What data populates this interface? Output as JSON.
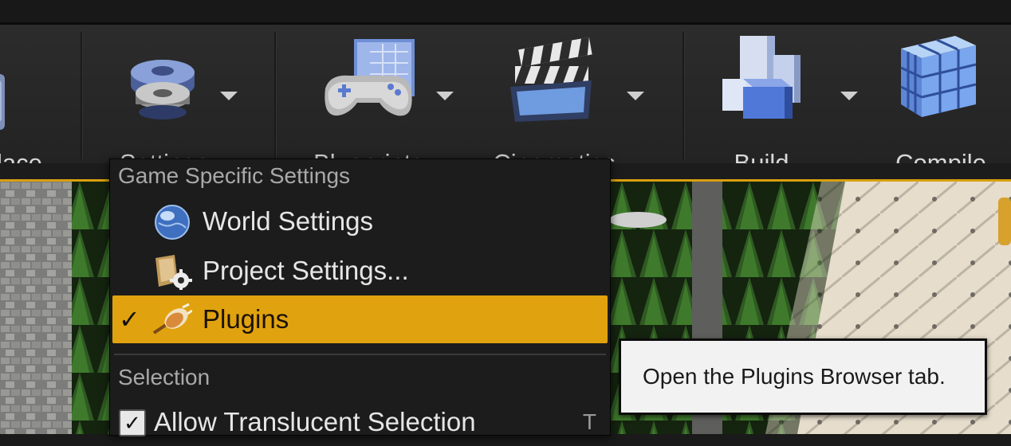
{
  "toolbar": {
    "buttons": [
      {
        "label": "lace",
        "icon": "marketplace-icon"
      },
      {
        "label": "Settings",
        "icon": "settings-gear-icon"
      },
      {
        "label": "Blueprints",
        "icon": "blueprints-gamepad-icon"
      },
      {
        "label": "Cinematics",
        "icon": "cinematics-clapper-icon"
      },
      {
        "label": "Build",
        "icon": "build-blocks-icon"
      },
      {
        "label": "Compile",
        "icon": "compile-cubes-icon"
      }
    ]
  },
  "menu": {
    "section_game": "Game Specific Settings",
    "items": [
      {
        "label": "World Settings",
        "icon": "globe-icon"
      },
      {
        "label": "Project Settings...",
        "icon": "project-settings-icon"
      },
      {
        "label": "Plugins",
        "icon": "plug-icon",
        "checked": true
      }
    ],
    "section_selection": "Selection",
    "selection_items": [
      {
        "label": "Allow Translucent Selection",
        "shortcut": "T",
        "checked": true
      }
    ]
  },
  "tooltip": {
    "text": "Open the Plugins Browser tab."
  },
  "colors": {
    "accent": "#e0a20f",
    "toolbar_bg": "#262626",
    "menu_bg": "#1c1c1c",
    "tooltip_bg": "#f2f2f2"
  }
}
